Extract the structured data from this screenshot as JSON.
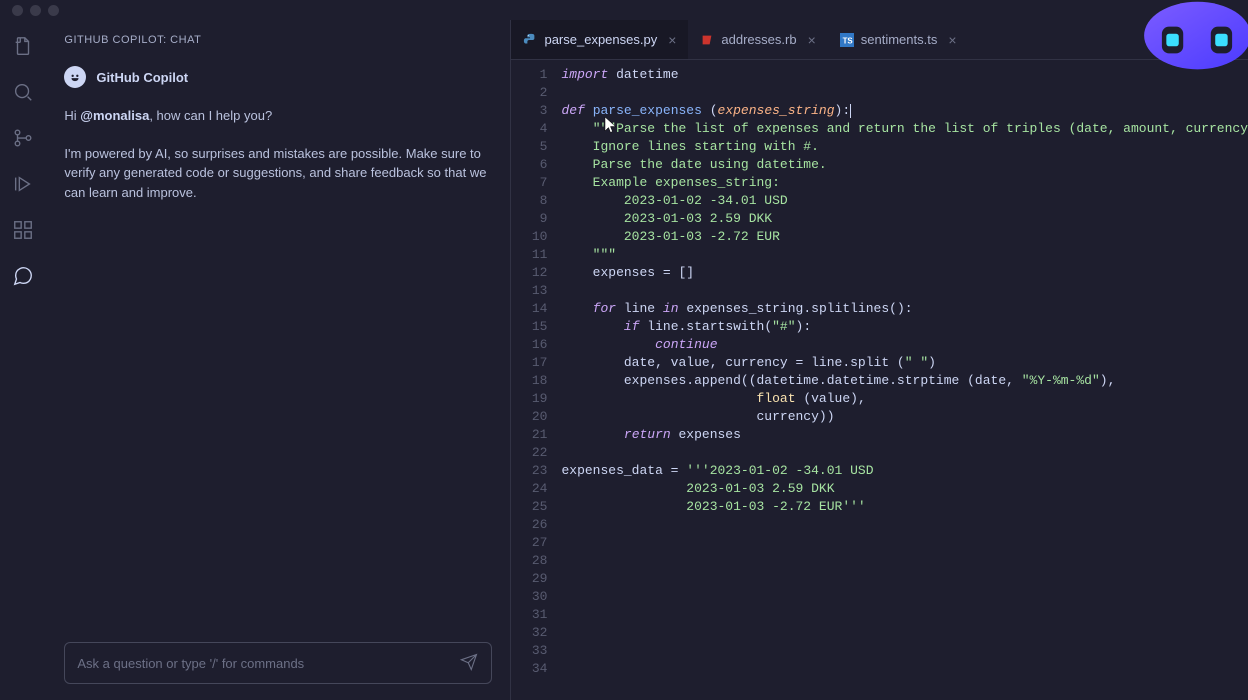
{
  "sidebar": {
    "title": "GITHUB COPILOT: CHAT",
    "botName": "GitHub Copilot",
    "greeting_prefix": "Hi ",
    "greeting_mention": "@monalisa",
    "greeting_suffix": ", how can I help you?",
    "description": "I'm powered by AI, so surprises and mistakes are possible. Make sure to verify any generated code or suggestions, and share feedback so that we can learn and improve.",
    "inputPlaceholder": "Ask a question or type '/' for commands"
  },
  "tabs": [
    {
      "label": "parse_expenses.py",
      "active": true,
      "lang": "py"
    },
    {
      "label": "addresses.rb",
      "active": false,
      "lang": "rb"
    },
    {
      "label": "sentiments.ts",
      "active": false,
      "lang": "ts"
    }
  ],
  "code": {
    "lineCount": 34,
    "lines": [
      [
        {
          "t": "import",
          "c": "keyword"
        },
        {
          "t": " datetime",
          "c": "default"
        }
      ],
      [],
      [
        {
          "t": "def",
          "c": "def"
        },
        {
          "t": " ",
          "c": "default"
        },
        {
          "t": "parse_expenses",
          "c": "func"
        },
        {
          "t": " (",
          "c": "default"
        },
        {
          "t": "expenses_string",
          "c": "param"
        },
        {
          "t": "):",
          "c": "default"
        }
      ],
      [
        {
          "t": "    ",
          "c": "default"
        },
        {
          "t": "\"\"\"Parse the list of expenses and return the list of triples (date, amount, currency",
          "c": "comment"
        }
      ],
      [
        {
          "t": "    Ignore lines starting with #.",
          "c": "comment"
        }
      ],
      [
        {
          "t": "    Parse the date using datetime.",
          "c": "comment"
        }
      ],
      [
        {
          "t": "    Example expenses_string:",
          "c": "comment"
        }
      ],
      [
        {
          "t": "        2023-01-02 -34.01 USD",
          "c": "comment"
        }
      ],
      [
        {
          "t": "        2023-01-03 2.59 DKK",
          "c": "comment"
        }
      ],
      [
        {
          "t": "        2023-01-03 -2.72 EUR",
          "c": "comment"
        }
      ],
      [
        {
          "t": "    \"\"\"",
          "c": "comment"
        }
      ],
      [
        {
          "t": "    expenses = []",
          "c": "default"
        }
      ],
      [],
      [
        {
          "t": "    ",
          "c": "default"
        },
        {
          "t": "for",
          "c": "keyword"
        },
        {
          "t": " line ",
          "c": "default"
        },
        {
          "t": "in",
          "c": "keyword"
        },
        {
          "t": " expenses_string.splitlines():",
          "c": "default"
        }
      ],
      [
        {
          "t": "        ",
          "c": "default"
        },
        {
          "t": "if",
          "c": "keyword"
        },
        {
          "t": " line.startswith(",
          "c": "default"
        },
        {
          "t": "\"#\"",
          "c": "string"
        },
        {
          "t": "):",
          "c": "default"
        }
      ],
      [
        {
          "t": "            ",
          "c": "default"
        },
        {
          "t": "continue",
          "c": "keyword"
        }
      ],
      [
        {
          "t": "        date, value, currency = line.split (",
          "c": "default"
        },
        {
          "t": "\" \"",
          "c": "string"
        },
        {
          "t": ")",
          "c": "default"
        }
      ],
      [
        {
          "t": "        expenses.append((datetime.datetime.strptime (date, ",
          "c": "default"
        },
        {
          "t": "\"%Y-%m-%d\"",
          "c": "string"
        },
        {
          "t": "),",
          "c": "default"
        }
      ],
      [
        {
          "t": "                         ",
          "c": "default"
        },
        {
          "t": "float",
          "c": "builtin"
        },
        {
          "t": " (value),",
          "c": "default"
        }
      ],
      [
        {
          "t": "                         currency))",
          "c": "default"
        }
      ],
      [
        {
          "t": "        ",
          "c": "default"
        },
        {
          "t": "return",
          "c": "keyword"
        },
        {
          "t": " expenses",
          "c": "default"
        }
      ],
      [],
      [
        {
          "t": "expenses_data = ",
          "c": "default"
        },
        {
          "t": "'''2023-01-02 -34.01 USD",
          "c": "string"
        }
      ],
      [
        {
          "t": "                2023-01-03 2.59 DKK",
          "c": "string"
        }
      ],
      [
        {
          "t": "                2023-01-03 -2.72 EUR'''",
          "c": "string"
        }
      ],
      [],
      [],
      [],
      [],
      [],
      [],
      [],
      [],
      []
    ]
  }
}
